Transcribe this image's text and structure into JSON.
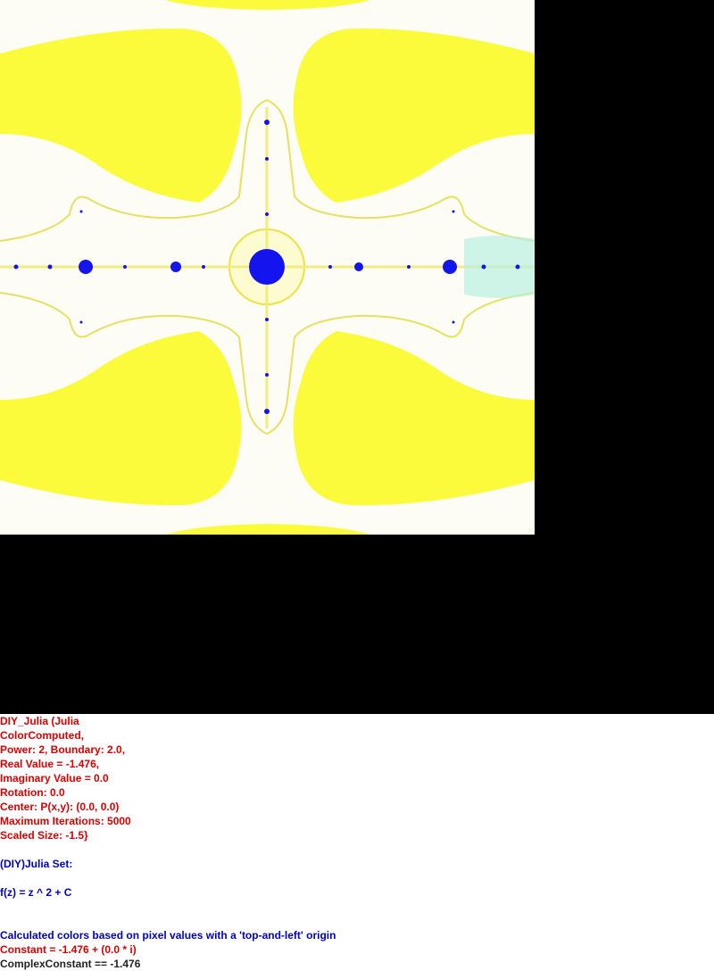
{
  "colors": {
    "fractal_background": "#fdfdf6",
    "fractal_yellow": "#fbfb3c",
    "fractal_blue": "#1414ee",
    "fractal_cyan": "#b8f0e0",
    "outer_background": "#000000",
    "parameter_text": "#dd0000",
    "formula_text": "#0000cc",
    "last_line_text": "#222222"
  },
  "info": {
    "lines": [
      {
        "text": "DIY_Julia (Julia",
        "color": "#dd0000"
      },
      {
        "text": "ColorComputed,",
        "color": "#dd0000"
      },
      {
        "text": "Power: 2, Boundary: 2.0,",
        "color": "#dd0000"
      },
      {
        "text": "Real Value = -1.476,",
        "color": "#dd0000"
      },
      {
        "text": "Imaginary Value = 0.0",
        "color": "#dd0000"
      },
      {
        "text": "Rotation: 0.0",
        "color": "#dd0000"
      },
      {
        "text": "Center: P(x,y): (0.0, 0.0)",
        "color": "#dd0000"
      },
      {
        "text": "Maximum Iterations: 5000",
        "color": "#dd0000"
      },
      {
        "text": "Scaled Size: -1.5}",
        "color": "#dd0000"
      },
      {
        "text": "",
        "color": "#dd0000"
      },
      {
        "text": "(DIY)Julia Set:",
        "color": "#0000cc"
      },
      {
        "text": "",
        "color": "#0000cc"
      },
      {
        "text": "f(z) = z ^ 2 + C",
        "color": "#0000cc"
      },
      {
        "text": "",
        "color": "#0000cc"
      },
      {
        "text": "",
        "color": "#0000cc"
      },
      {
        "text": "Calculated colors based on pixel values with a 'top-and-left' origin",
        "color": "#0000cc"
      },
      {
        "text": "Constant = -1.476 + (0.0 * i)",
        "color": "#dd0000"
      },
      {
        "text": "ComplexConstant == -1.476",
        "color": "#222222"
      }
    ]
  }
}
